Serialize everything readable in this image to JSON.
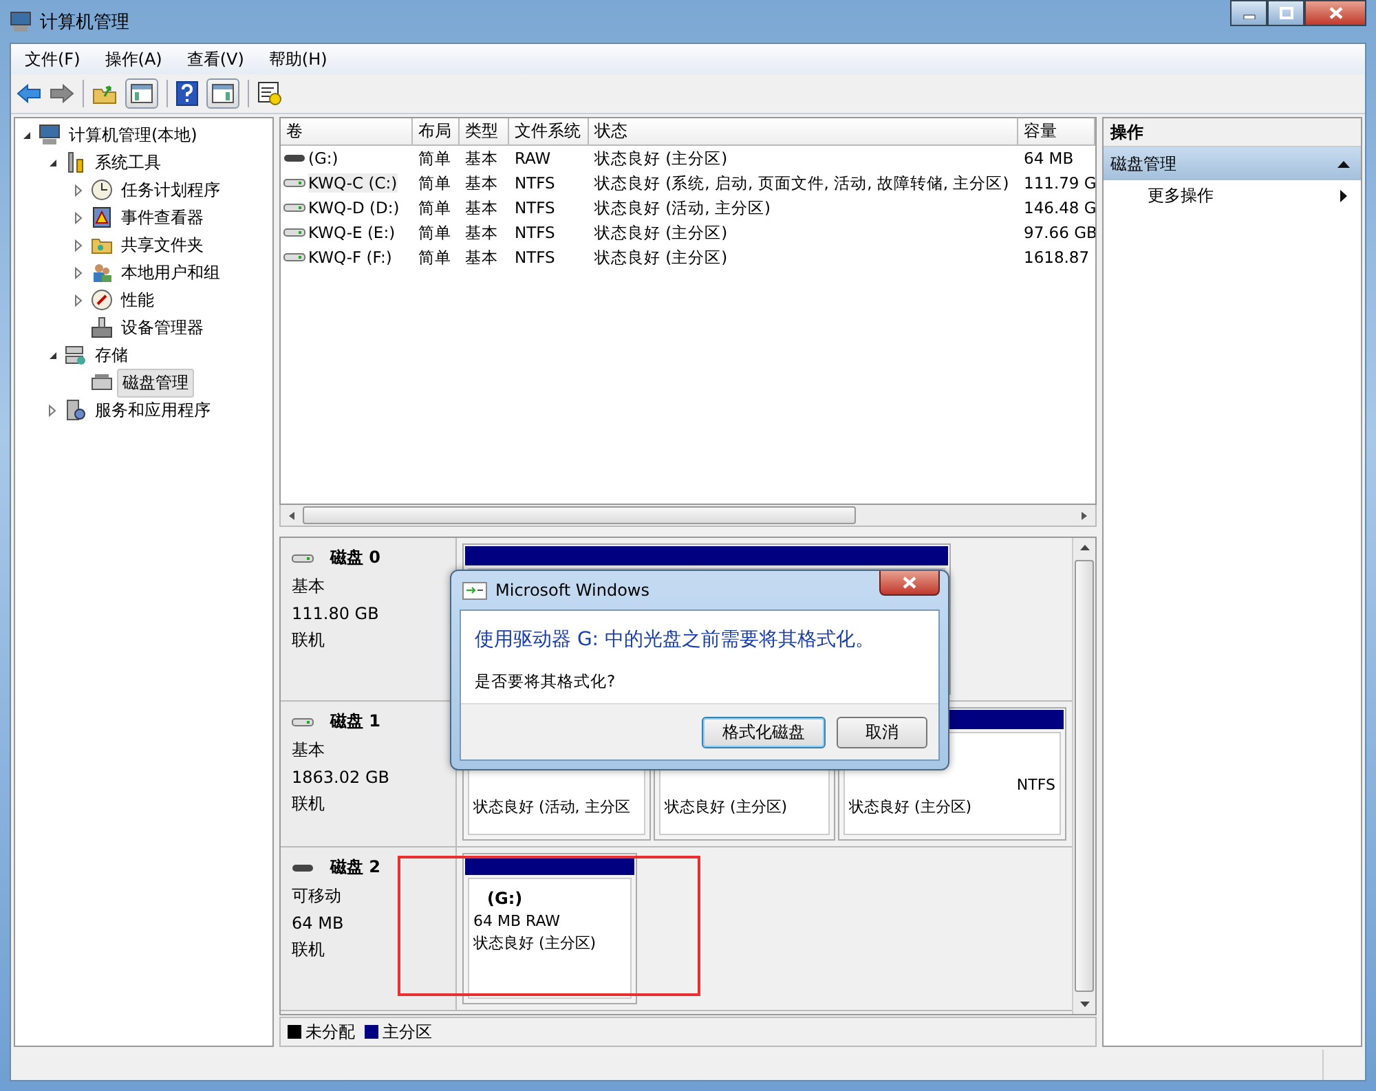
{
  "window": {
    "title": "计算机管理"
  },
  "menu": [
    "文件(F)",
    "操作(A)",
    "查看(V)",
    "帮助(H)"
  ],
  "tree": [
    {
      "label": "计算机管理(本地)",
      "kind": "computer",
      "selected": false,
      "expanded": true,
      "children": [
        {
          "label": "系统工具",
          "kind": "tools",
          "selected": false,
          "expanded": true,
          "children": [
            {
              "label": "任务计划程序",
              "kind": "clock",
              "selected": false,
              "expanded": false
            },
            {
              "label": "事件查看器",
              "kind": "log",
              "selected": false,
              "expanded": false
            },
            {
              "label": "共享文件夹",
              "kind": "folder",
              "selected": false,
              "expanded": false
            },
            {
              "label": "本地用户和组",
              "kind": "users",
              "selected": false,
              "expanded": false
            },
            {
              "label": "性能",
              "kind": "gauge",
              "selected": false,
              "expanded": false
            },
            {
              "label": "设备管理器",
              "kind": "device",
              "selected": false
            }
          ]
        },
        {
          "label": "存储",
          "kind": "storage",
          "selected": false,
          "expanded": true,
          "children": [
            {
              "label": "磁盘管理",
              "kind": "disk",
              "selected": true
            }
          ]
        },
        {
          "label": "服务和应用程序",
          "kind": "services",
          "selected": false,
          "expanded": false
        }
      ]
    }
  ],
  "table": {
    "columns": [
      "卷",
      "布局",
      "类型",
      "文件系统",
      "状态",
      "容量"
    ],
    "rows": [
      {
        "kind": "removable",
        "focused": false,
        "cells": [
          "(G:)",
          "简单",
          "基本",
          "RAW",
          "状态良好 (主分区)",
          "64 MB"
        ]
      },
      {
        "kind": "fixed",
        "focused": true,
        "cells": [
          "KWQ-C (C:)",
          "简单",
          "基本",
          "NTFS",
          "状态良好 (系统, 启动, 页面文件, 活动, 故障转储, 主分区)",
          "111.79 G"
        ]
      },
      {
        "kind": "fixed",
        "focused": false,
        "cells": [
          "KWQ-D (D:)",
          "简单",
          "基本",
          "NTFS",
          "状态良好 (活动, 主分区)",
          "146.48 G"
        ]
      },
      {
        "kind": "fixed",
        "focused": false,
        "cells": [
          "KWQ-E (E:)",
          "简单",
          "基本",
          "NTFS",
          "状态良好 (主分区)",
          "97.66 GB"
        ]
      },
      {
        "kind": "fixed",
        "focused": false,
        "cells": [
          "KWQ-F (F:)",
          "简单",
          "基本",
          "NTFS",
          "状态良好 (主分区)",
          "1618.87"
        ]
      }
    ]
  },
  "disks": [
    {
      "kind": "fixed",
      "name": "磁盘 0",
      "type": "基本",
      "size": "111.80 GB",
      "state": "联机",
      "partitions": [
        {
          "kind": "primary"
        }
      ]
    },
    {
      "kind": "fixed",
      "name": "磁盘 1",
      "type": "基本",
      "size": "1863.02 GB",
      "state": "联机",
      "partitions": [
        {
          "kind": "primary",
          "lines": [
            "状态良好 (活动, 主分区"
          ]
        },
        {
          "kind": "primary",
          "lines": [
            "状态良好 (主分区)"
          ]
        },
        {
          "kind": "primary",
          "lines": [
            "NTFS",
            "状态良好 (主分区)"
          ]
        }
      ]
    },
    {
      "kind": "removable",
      "name": "磁盘 2",
      "type": "可移动",
      "size": "64 MB",
      "state": "联机",
      "partitions": [
        {
          "kind": "primary",
          "title": "(G:)",
          "lines": [
            "64 MB  RAW",
            "状态良好 (主分区)"
          ]
        }
      ]
    }
  ],
  "legend": [
    {
      "label": "未分配",
      "color": "#000000"
    },
    {
      "label": "主分区",
      "color": "#000080"
    }
  ],
  "actions": {
    "header": "操作",
    "section": {
      "label": "磁盘管理",
      "expanded": true
    },
    "items": [
      "更多操作"
    ]
  },
  "dialog": {
    "title": "Microsoft Windows",
    "instruction": "使用驱动器 G: 中的光盘之前需要将其格式化。",
    "message": "是否要将其格式化?",
    "buttons": [
      {
        "label": "格式化磁盘",
        "default": true
      },
      {
        "label": "取消",
        "default": false
      }
    ]
  }
}
